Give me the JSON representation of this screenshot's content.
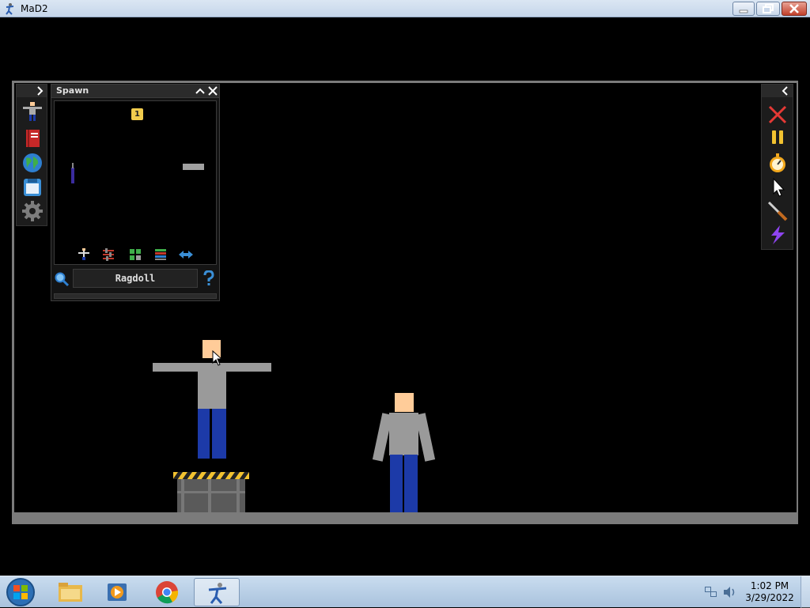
{
  "window": {
    "title": "MaD2",
    "minimize_icon": "minimize-icon",
    "restore_icon": "restore-icon",
    "close_icon": "close-icon"
  },
  "left_toolbar": {
    "toggle_icon": "chevron-right-icon",
    "items": [
      {
        "name": "ragdoll-icon"
      },
      {
        "name": "book-icon"
      },
      {
        "name": "globe-icon"
      },
      {
        "name": "save-icon"
      },
      {
        "name": "settings-gear-icon"
      }
    ]
  },
  "spawn_panel": {
    "title": "Spawn",
    "page_number": "1",
    "search_value": "Ragdoll",
    "category_icons": [
      "ragdoll-category-icon",
      "sliders-category-icon",
      "grid-category-icon",
      "stack-category-icon",
      "swap-arrows-icon"
    ],
    "search_icon": "magnifier-icon",
    "help_icon": "question-mark-icon"
  },
  "right_toolbar": {
    "toggle_icon": "chevron-left-icon",
    "items": [
      {
        "name": "delete-x-icon"
      },
      {
        "name": "pause-icon"
      },
      {
        "name": "stopwatch-icon"
      },
      {
        "name": "pointer-cursor-icon"
      },
      {
        "name": "knife-icon"
      },
      {
        "name": "lightning-icon"
      }
    ]
  },
  "colors": {
    "shirt": "#9a9a9a",
    "pants": "#1c3aa8",
    "skin": "#ffcc99",
    "frame": "#7b7b7b",
    "hazard_yellow": "#f2c230"
  },
  "taskbar": {
    "items": [
      "start-orb-icon",
      "file-explorer-icon",
      "media-player-icon",
      "chrome-icon",
      "mad2-app-icon"
    ],
    "time": "1:02 PM",
    "date": "3/29/2022"
  }
}
